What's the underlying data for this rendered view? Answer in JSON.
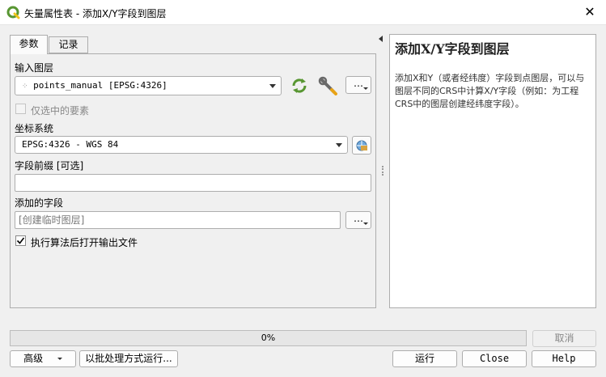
{
  "window": {
    "title": "矢量属性表 - 添加X/Y字段到图层",
    "close_glyph": "✕"
  },
  "tabs": [
    {
      "label": "参数",
      "active": true
    },
    {
      "label": "记录",
      "active": false
    }
  ],
  "params": {
    "input_layer_label": "输入图层",
    "input_layer_value": "points_manual [EPSG:4326]",
    "selected_only_label": "仅选中的要素",
    "crs_label": "坐标系统",
    "crs_value": "EPSG:4326 - WGS 84",
    "prefix_label": "字段前缀 [可选]",
    "prefix_value": "",
    "added_fields_label": "添加的字段",
    "added_fields_placeholder": "[创建临时图层]",
    "open_output_label": "执行算法后打开输出文件",
    "open_output_checked": true,
    "more_button": "…"
  },
  "help": {
    "title": "添加X/Y字段到图层",
    "body": "添加X和Y（或者经纬度）字段到点图层，可以与图层不同的CRS中计算X/Y字段（例如：为工程CRS中的图层创建经纬度字段）。"
  },
  "progress": {
    "value": 0,
    "text": "0%"
  },
  "buttons": {
    "cancel": "取消",
    "advanced": "高级",
    "batch": "以批处理方式运行...",
    "run": "运行",
    "close": "Close",
    "help": "Help"
  },
  "colors": {
    "accent_green": "#589632",
    "panel_border": "#adadad"
  }
}
